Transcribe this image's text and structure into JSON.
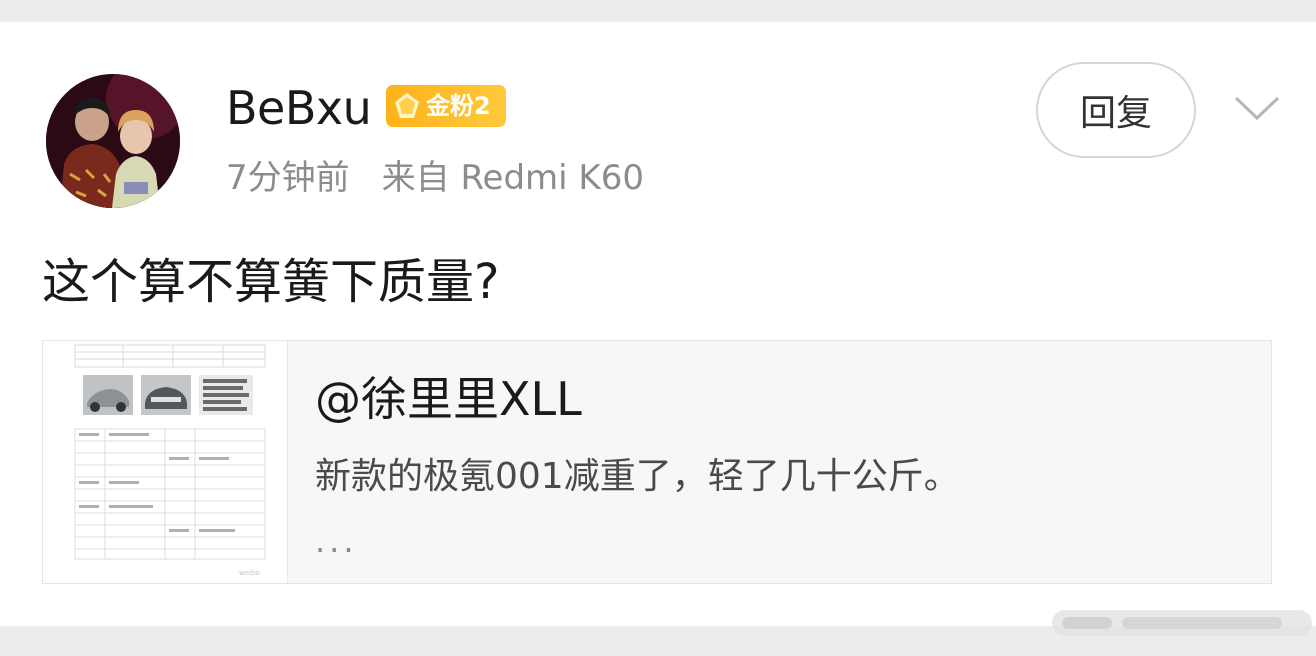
{
  "post": {
    "username": "BeBxu",
    "badge_label": "金粉2",
    "time": "7分钟前",
    "source": "来自 Redmi K60",
    "reply_label": "回复",
    "text": "这个算不算簧下质量?"
  },
  "quote": {
    "author": "@徐里里XLL",
    "body": "新款的极氪001减重了，轻了几十公斤。",
    "more": "..."
  },
  "icons": {
    "badge": "diamond-badge-icon",
    "menu": "chevron-down-icon"
  },
  "colors": {
    "badge_gold": "#ffb21a",
    "page_bg": "#ececec"
  }
}
